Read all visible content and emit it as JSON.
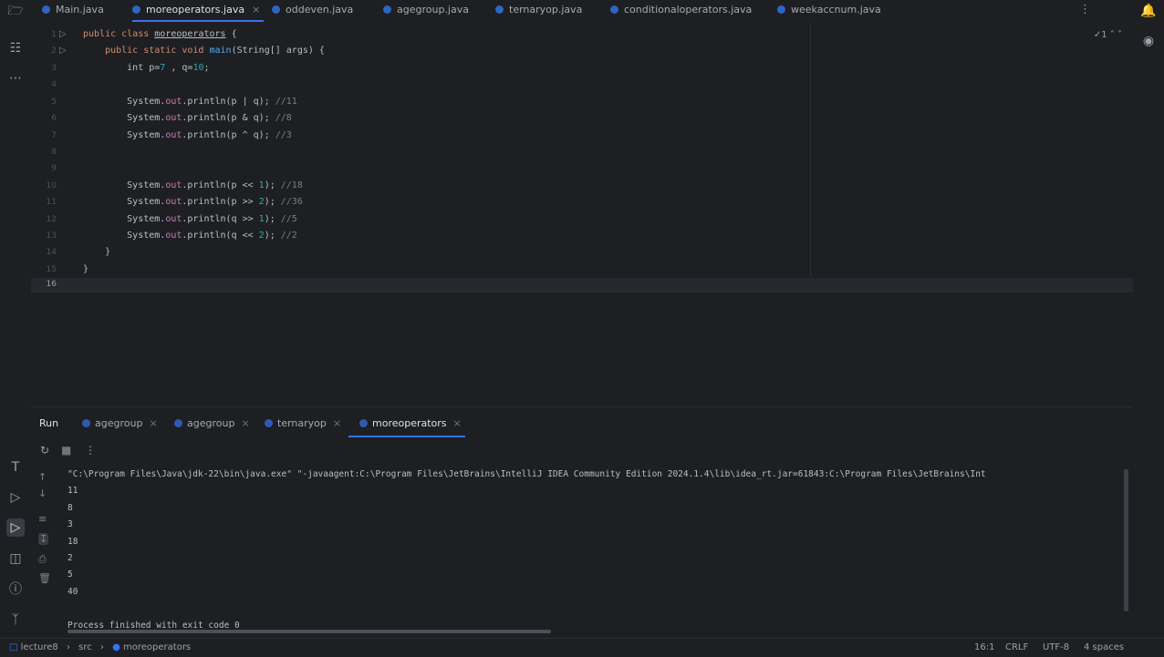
{
  "editor_tabs": [
    {
      "label": "Main.java",
      "active": false
    },
    {
      "label": "moreoperators.java",
      "active": true
    },
    {
      "label": "oddeven.java",
      "active": false
    },
    {
      "label": "agegroup.java",
      "active": false
    },
    {
      "label": "ternaryop.java",
      "active": false
    },
    {
      "label": "conditionaloperators.java",
      "active": false
    },
    {
      "label": "weekaccnum.java",
      "active": false
    }
  ],
  "editor": {
    "inspection": "1",
    "line_numbers": [
      "1",
      "2",
      "3",
      "4",
      "5",
      "6",
      "7",
      "8",
      "9",
      "10",
      "11",
      "12",
      "13",
      "14",
      "15",
      "16"
    ],
    "lines": {
      "l1_kw": "public class ",
      "l1_cls": "moreoperators",
      "l1_end": " {",
      "l2_kw": "    public static void ",
      "l2_fn": "main",
      "l2_end": "(String[] args) {",
      "l3_a": "        int p=",
      "l3_n1": "7",
      "l3_b": " , q=",
      "l3_n2": "10",
      "l3_c": ";",
      "l5_a": "        System.",
      "l5_f": "out",
      "l5_b": ".println(p | q); ",
      "l5_cm": "//11",
      "l6_a": "        System.",
      "l6_f": "out",
      "l6_b": ".println(p & q); ",
      "l6_cm": "//8",
      "l7_a": "        System.",
      "l7_f": "out",
      "l7_b": ".println(p ^ q); ",
      "l7_cm": "//3",
      "l10_a": "        System.",
      "l10_f": "out",
      "l10_b": ".println(p << ",
      "l10_n": "1",
      "l10_c": "); ",
      "l10_cm": "//18",
      "l11_a": "        System.",
      "l11_f": "out",
      "l11_b": ".println(p >> ",
      "l11_n": "2",
      "l11_c": "); ",
      "l11_cm": "//36",
      "l12_a": "        System.",
      "l12_f": "out",
      "l12_b": ".println(q >> ",
      "l12_n": "1",
      "l12_c": "); ",
      "l12_cm": "//5",
      "l13_a": "        System.",
      "l13_f": "out",
      "l13_b": ".println(q << ",
      "l13_n": "2",
      "l13_c": "); ",
      "l13_cm": "//2",
      "l14": "    }",
      "l15": "}"
    }
  },
  "run_panel": {
    "title": "Run",
    "tabs": [
      {
        "label": "agegroup"
      },
      {
        "label": "agegroup"
      },
      {
        "label": "ternaryop"
      },
      {
        "label": "moreoperators"
      }
    ],
    "command": "\"C:\\Program Files\\Java\\jdk-22\\bin\\java.exe\" \"-javaagent:C:\\Program Files\\JetBrains\\IntelliJ IDEA Community Edition 2024.1.4\\lib\\idea_rt.jar=61843:C:\\Program Files\\JetBrains\\Int",
    "output": [
      "11",
      "8",
      "3",
      "18",
      "2",
      "5",
      "40"
    ],
    "finished": "Process finished with exit code 0"
  },
  "status_bar": {
    "project": "lecture8",
    "folder": "src",
    "file": "moreoperators",
    "position": "16:1",
    "line_ending": "CRLF",
    "encoding": "UTF-8",
    "indent": "4 spaces"
  },
  "colors": {
    "accent": "#3574f0",
    "background": "#1e1f22",
    "keyword": "#cf8e6d",
    "number": "#2aacb8",
    "comment": "#7a7e85",
    "field": "#c77dbb"
  }
}
